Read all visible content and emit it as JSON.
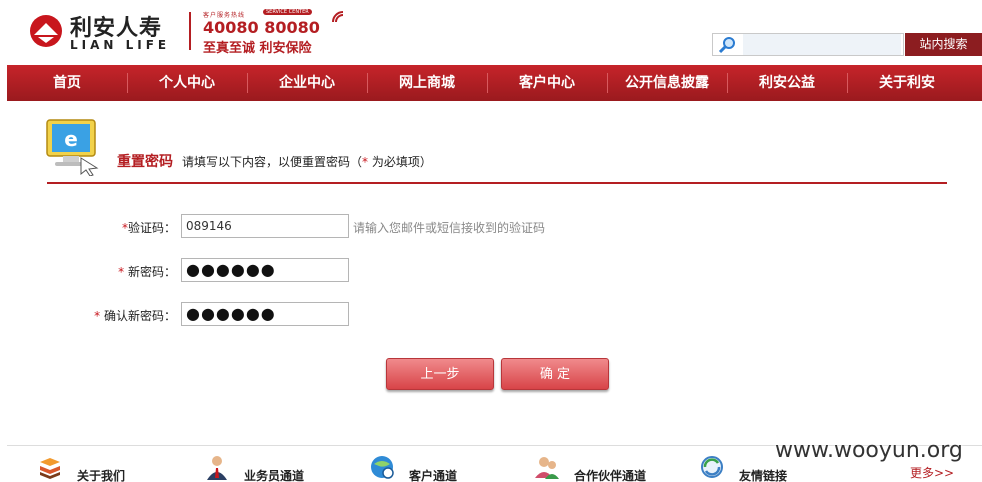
{
  "header": {
    "logo_cn": "利安人寿",
    "logo_en": "LIAN LIFE",
    "hotline_caption": "客户服务热线",
    "hotline_badge": "SERVICE CENTER",
    "hotline_number": "40080 80080",
    "slogan": "至真至诚 利安保险",
    "search": {
      "placeholder": "",
      "value": "",
      "button_label": "站内搜索"
    }
  },
  "nav": {
    "items": [
      "首页",
      "个人中心",
      "企业中心",
      "网上商城",
      "客户中心",
      "公开信息披露",
      "利安公益",
      "关于利安"
    ]
  },
  "section": {
    "title": "重置密码",
    "hint_prefix": "请填写以下内容，以便重置密码（",
    "required_mark": "*",
    "hint_suffix": "为必填项）"
  },
  "form": {
    "code": {
      "label": "验证码：",
      "value": "089146",
      "hint": "请输入您邮件或短信接收到的验证码"
    },
    "new_password": {
      "label": "新密码：",
      "value": "●●●●●●"
    },
    "confirm_password": {
      "label": "确认新密码：",
      "value": "●●●●●●"
    },
    "prev_button": "上一步",
    "confirm_button": "确 定"
  },
  "footer": {
    "items": [
      "关于我们",
      "业务员通道",
      "客户通道",
      "合作伙伴通道",
      "友情链接"
    ],
    "more": "更多>>",
    "watermark": "www.wooyun.org"
  },
  "colors": {
    "brand_red": "#b41e22",
    "nav_red": "#c6242a",
    "button_pink": "#e05a5e"
  }
}
